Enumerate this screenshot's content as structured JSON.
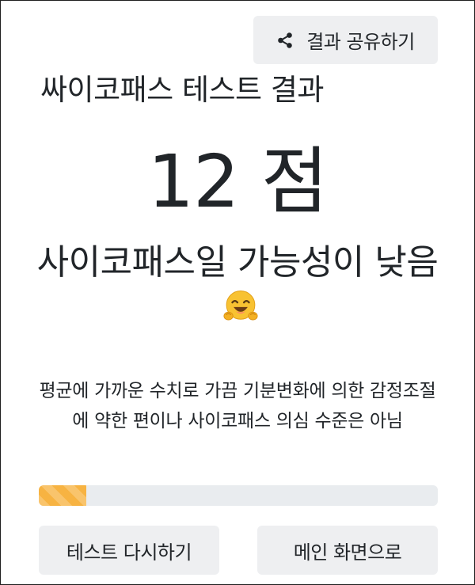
{
  "share": {
    "label": "결과 공유하기",
    "icon": "share-icon"
  },
  "title": "싸이코패스 테스트 결과",
  "score": {
    "text": "12 점",
    "value": 12
  },
  "verdict": {
    "text": "사이코패스일 가능성이 낮음",
    "emoji_icon": "hugging-face-icon"
  },
  "description": "평균에 가까운 수치로 가끔 기분변화에 의한 감정조절에 약한 편이나 사이코패스 의심 수준은 아님",
  "progress": {
    "fraction": 0.12,
    "color": "#f7b342",
    "track_color": "#e9ecef"
  },
  "buttons": {
    "retry_label": "테스트 다시하기",
    "home_label": "메인 화면으로"
  }
}
